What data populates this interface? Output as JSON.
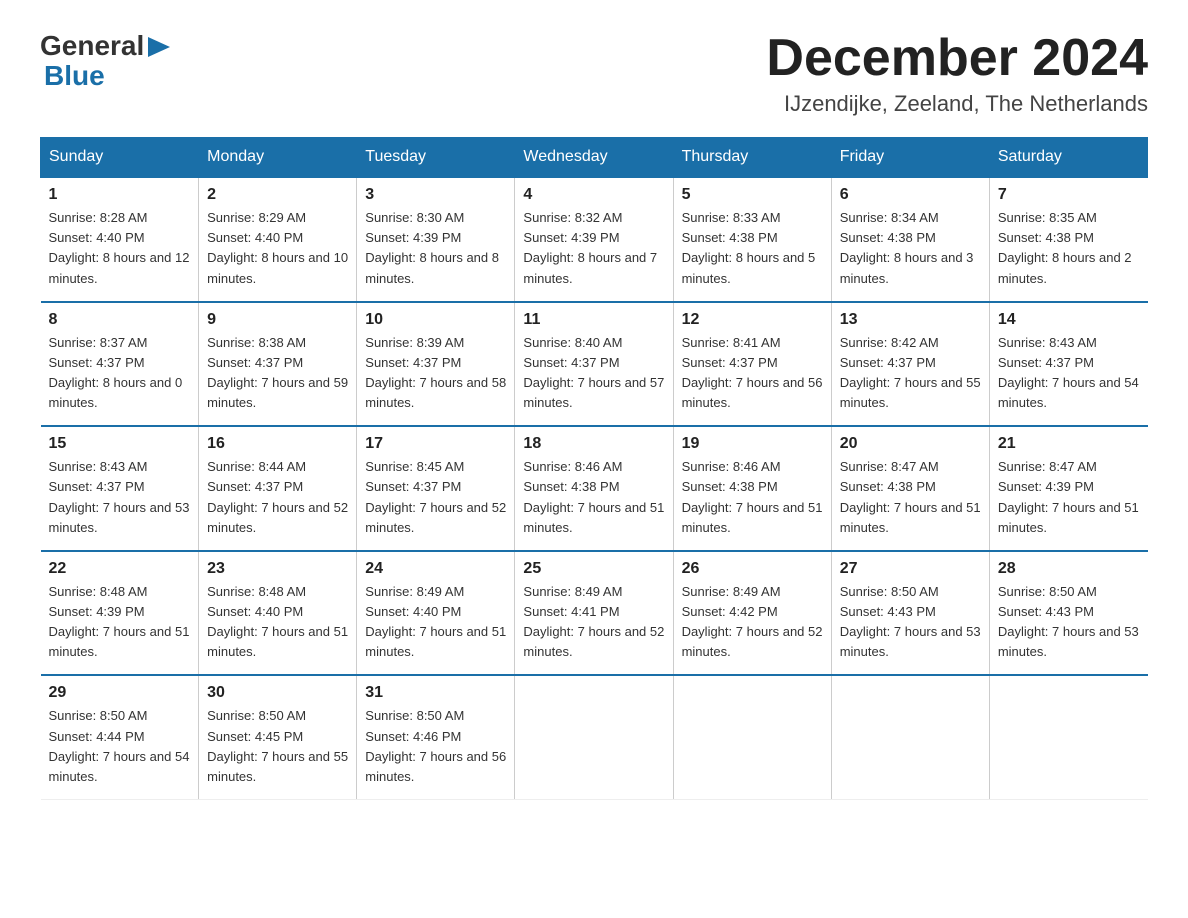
{
  "header": {
    "logo_general": "General",
    "logo_blue": "Blue",
    "month_title": "December 2024",
    "location": "IJzendijke, Zeeland, The Netherlands"
  },
  "weekdays": [
    "Sunday",
    "Monday",
    "Tuesday",
    "Wednesday",
    "Thursday",
    "Friday",
    "Saturday"
  ],
  "weeks": [
    [
      {
        "day": "1",
        "sunrise": "8:28 AM",
        "sunset": "4:40 PM",
        "daylight": "8 hours and 12 minutes."
      },
      {
        "day": "2",
        "sunrise": "8:29 AM",
        "sunset": "4:40 PM",
        "daylight": "8 hours and 10 minutes."
      },
      {
        "day": "3",
        "sunrise": "8:30 AM",
        "sunset": "4:39 PM",
        "daylight": "8 hours and 8 minutes."
      },
      {
        "day": "4",
        "sunrise": "8:32 AM",
        "sunset": "4:39 PM",
        "daylight": "8 hours and 7 minutes."
      },
      {
        "day": "5",
        "sunrise": "8:33 AM",
        "sunset": "4:38 PM",
        "daylight": "8 hours and 5 minutes."
      },
      {
        "day": "6",
        "sunrise": "8:34 AM",
        "sunset": "4:38 PM",
        "daylight": "8 hours and 3 minutes."
      },
      {
        "day": "7",
        "sunrise": "8:35 AM",
        "sunset": "4:38 PM",
        "daylight": "8 hours and 2 minutes."
      }
    ],
    [
      {
        "day": "8",
        "sunrise": "8:37 AM",
        "sunset": "4:37 PM",
        "daylight": "8 hours and 0 minutes."
      },
      {
        "day": "9",
        "sunrise": "8:38 AM",
        "sunset": "4:37 PM",
        "daylight": "7 hours and 59 minutes."
      },
      {
        "day": "10",
        "sunrise": "8:39 AM",
        "sunset": "4:37 PM",
        "daylight": "7 hours and 58 minutes."
      },
      {
        "day": "11",
        "sunrise": "8:40 AM",
        "sunset": "4:37 PM",
        "daylight": "7 hours and 57 minutes."
      },
      {
        "day": "12",
        "sunrise": "8:41 AM",
        "sunset": "4:37 PM",
        "daylight": "7 hours and 56 minutes."
      },
      {
        "day": "13",
        "sunrise": "8:42 AM",
        "sunset": "4:37 PM",
        "daylight": "7 hours and 55 minutes."
      },
      {
        "day": "14",
        "sunrise": "8:43 AM",
        "sunset": "4:37 PM",
        "daylight": "7 hours and 54 minutes."
      }
    ],
    [
      {
        "day": "15",
        "sunrise": "8:43 AM",
        "sunset": "4:37 PM",
        "daylight": "7 hours and 53 minutes."
      },
      {
        "day": "16",
        "sunrise": "8:44 AM",
        "sunset": "4:37 PM",
        "daylight": "7 hours and 52 minutes."
      },
      {
        "day": "17",
        "sunrise": "8:45 AM",
        "sunset": "4:37 PM",
        "daylight": "7 hours and 52 minutes."
      },
      {
        "day": "18",
        "sunrise": "8:46 AM",
        "sunset": "4:38 PM",
        "daylight": "7 hours and 51 minutes."
      },
      {
        "day": "19",
        "sunrise": "8:46 AM",
        "sunset": "4:38 PM",
        "daylight": "7 hours and 51 minutes."
      },
      {
        "day": "20",
        "sunrise": "8:47 AM",
        "sunset": "4:38 PM",
        "daylight": "7 hours and 51 minutes."
      },
      {
        "day": "21",
        "sunrise": "8:47 AM",
        "sunset": "4:39 PM",
        "daylight": "7 hours and 51 minutes."
      }
    ],
    [
      {
        "day": "22",
        "sunrise": "8:48 AM",
        "sunset": "4:39 PM",
        "daylight": "7 hours and 51 minutes."
      },
      {
        "day": "23",
        "sunrise": "8:48 AM",
        "sunset": "4:40 PM",
        "daylight": "7 hours and 51 minutes."
      },
      {
        "day": "24",
        "sunrise": "8:49 AM",
        "sunset": "4:40 PM",
        "daylight": "7 hours and 51 minutes."
      },
      {
        "day": "25",
        "sunrise": "8:49 AM",
        "sunset": "4:41 PM",
        "daylight": "7 hours and 52 minutes."
      },
      {
        "day": "26",
        "sunrise": "8:49 AM",
        "sunset": "4:42 PM",
        "daylight": "7 hours and 52 minutes."
      },
      {
        "day": "27",
        "sunrise": "8:50 AM",
        "sunset": "4:43 PM",
        "daylight": "7 hours and 53 minutes."
      },
      {
        "day": "28",
        "sunrise": "8:50 AM",
        "sunset": "4:43 PM",
        "daylight": "7 hours and 53 minutes."
      }
    ],
    [
      {
        "day": "29",
        "sunrise": "8:50 AM",
        "sunset": "4:44 PM",
        "daylight": "7 hours and 54 minutes."
      },
      {
        "day": "30",
        "sunrise": "8:50 AM",
        "sunset": "4:45 PM",
        "daylight": "7 hours and 55 minutes."
      },
      {
        "day": "31",
        "sunrise": "8:50 AM",
        "sunset": "4:46 PM",
        "daylight": "7 hours and 56 minutes."
      },
      null,
      null,
      null,
      null
    ]
  ]
}
